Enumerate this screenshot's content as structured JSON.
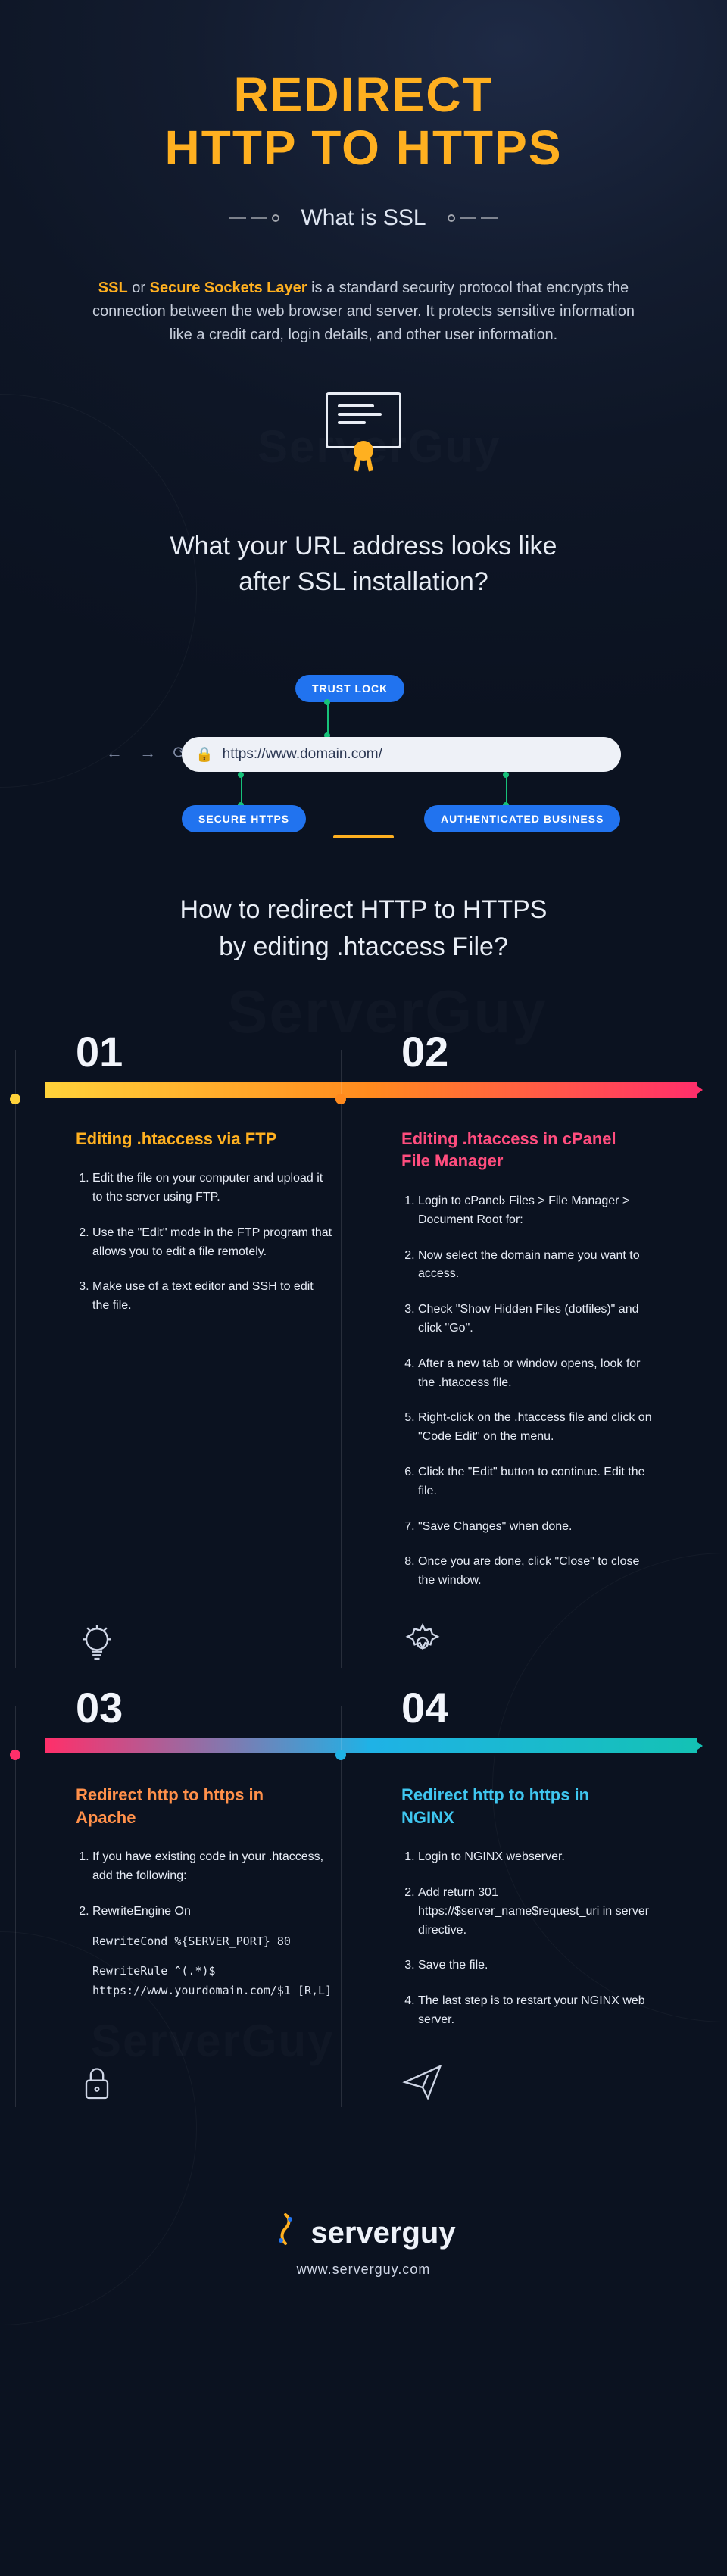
{
  "title_line1": "REDIRECT",
  "title_line2": "HTTP TO HTTPS",
  "tagline": "What is SSL",
  "watermark": "ServerGuy",
  "intro": {
    "highlight1": "SSL",
    "highlight2": "Secure Sockets Layer",
    "before": " or ",
    "after": " is a standard security protocol that encrypts the connection between the web browser and server. It protects sensitive information like a credit card, login details, and other user information."
  },
  "q1_line1": "What your URL address looks like",
  "q1_line2": "after SSL installation?",
  "urlbar": {
    "nav_glyphs": "←  →  ⟳",
    "lock_glyph": "🔒",
    "url": "https://www.domain.com/"
  },
  "pills": {
    "trust": "TRUST LOCK",
    "https": "SECURE HTTPS",
    "auth": "AUTHENTICATED BUSINESS"
  },
  "q2_line1": "How to redirect HTTP to HTTPS",
  "q2_line2": "by editing .htaccess File?",
  "steps": {
    "s1": {
      "num": "01",
      "title": "Editing .htaccess via FTP",
      "items": [
        "Edit the file on your computer and upload it to the server using FTP.",
        "Use the \"Edit\" mode in the FTP program that allows you to edit a file remotely.",
        "Make use of a text editor and SSH to edit the file."
      ]
    },
    "s2": {
      "num": "02",
      "title": "Editing .htaccess in cPanel File Manager",
      "items": [
        "Login to cPanel› Files > File Manager > Document Root for:",
        "Now select the domain name you want to access.",
        "Check \"Show Hidden Files (dotfiles)\" and click \"Go\".",
        "After a new tab or window opens, look for the .htaccess file.",
        "Right-click on the .htaccess file and click on \"Code Edit\" on the menu.",
        "Click the \"Edit\" button to continue. Edit the file.",
        "\"Save Changes\" when done.",
        "Once you are done, click \"Close\" to close the window."
      ]
    },
    "s3": {
      "num": "03",
      "title": "Redirect http to https in Apache",
      "items": [
        "If you have existing code in your .htaccess, add the following:",
        "RewriteEngine On"
      ],
      "code1": "RewriteCond %{SERVER_PORT} 80",
      "code2": "RewriteRule ^(.*)$ https://www.yourdomain.com/$1 [R,L]"
    },
    "s4": {
      "num": "04",
      "title": "Redirect http to https in NGINX",
      "items": [
        "Login to NGINX webserver.",
        "Add return 301 https://$server_name$request_uri in server directive.",
        "Save the file.",
        "The last step is to restart your NGINX web server."
      ]
    }
  },
  "brand": {
    "mark": "⌘",
    "name": "serverguy",
    "site": "www.serverguy.com"
  },
  "colors": {
    "accent": "#ffb020",
    "blue": "#2173ef",
    "pink": "#ff2f6a",
    "cyan": "#1fb2e6",
    "teal": "#14c2b5"
  }
}
